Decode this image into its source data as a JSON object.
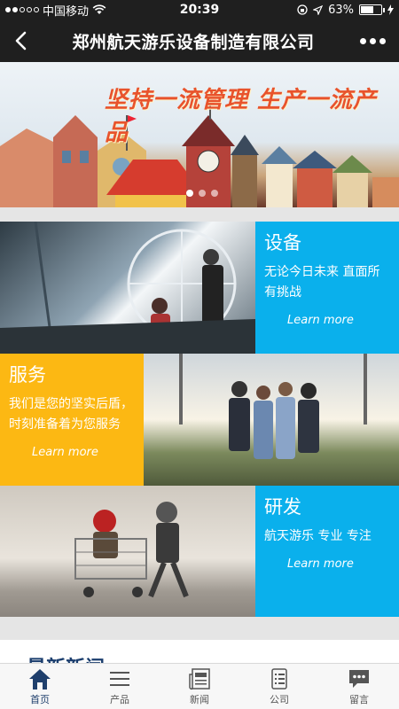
{
  "status": {
    "carrier": "中国移动",
    "time": "20:39",
    "battery": "63%",
    "battery_level": 0.63
  },
  "nav": {
    "title": "郑州航天游乐设备制造有限公司"
  },
  "banner": {
    "slogan": "坚持一流管理  生产一流产品",
    "slide_count": 3,
    "active_slide": 1
  },
  "features": [
    {
      "title": "设备",
      "desc": "无论今日未来 直面所有挑战",
      "link": "Learn more",
      "color": "#0ab0ec"
    },
    {
      "title": "服务",
      "desc": "我们是您的坚实后盾，时刻准备着为您服务",
      "link": "Learn more",
      "color": "#fcb813"
    },
    {
      "title": "研发",
      "desc": "航天游乐  专业  专注",
      "link": "Learn more",
      "color": "#0ab0ec"
    }
  ],
  "news": {
    "title": "最新新闻"
  },
  "tabs": [
    {
      "label": "首页",
      "icon": "home-icon"
    },
    {
      "label": "产品",
      "icon": "menu-icon"
    },
    {
      "label": "新闻",
      "icon": "newspaper-icon"
    },
    {
      "label": "公司",
      "icon": "document-icon"
    },
    {
      "label": "留言",
      "icon": "chat-icon"
    }
  ],
  "colors": {
    "nav_bg": "#1f1f1f",
    "blue_panel": "#0ab0ec",
    "yellow_panel": "#fcb813",
    "tab_active": "#1f3f6c"
  }
}
